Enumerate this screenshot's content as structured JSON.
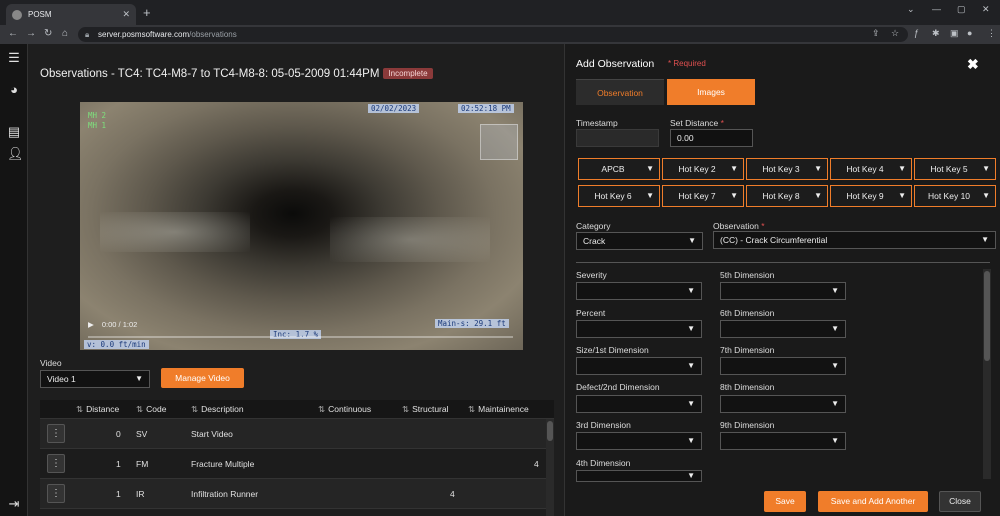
{
  "browser": {
    "tab_title": "POSM",
    "url_domain": "server.posmsoftware.com",
    "url_path": "/observations"
  },
  "main": {
    "title": "Observations - TC4: TC4-M8-7 to TC4-M8-8: 05-05-2009 01:44PM",
    "status": "Incomplete",
    "video_overlay": {
      "mh_top": "MH 2",
      "mh_bottom": "MH 1",
      "date": "02/02/2023",
      "time": "02:52:18 PM",
      "time_display": "0:00 / 1:02",
      "main_s": "Main-s:",
      "main_s_val": "29.1 ft",
      "inc": "Inc:",
      "inc_val": "1.7 %",
      "v_label": "v:",
      "v_val": "0.0 ft/min"
    },
    "video_label": "Video",
    "video_select": "Video 1",
    "manage_video": "Manage Video",
    "table": {
      "columns": [
        "Distance",
        "Code",
        "Description",
        "Continuous",
        "Structural",
        "Maintainence"
      ],
      "rows": [
        {
          "distance": "0",
          "code": "SV",
          "description": "Start Video",
          "continuous": "",
          "structural": "",
          "maintenance": ""
        },
        {
          "distance": "1",
          "code": "FM",
          "description": "Fracture Multiple",
          "continuous": "",
          "structural": "",
          "maintenance": "4"
        },
        {
          "distance": "1",
          "code": "IR",
          "description": "Infiltration Runner",
          "continuous": "",
          "structural": "4",
          "maintenance": ""
        }
      ]
    }
  },
  "panel": {
    "title": "Add Observation",
    "required": "* Required",
    "tabs": [
      "Observation",
      "Images"
    ],
    "timestamp_label": "Timestamp",
    "set_distance_label": "Set Distance",
    "set_distance_value": "0.00",
    "hotkeys": [
      "APCB",
      "Hot Key 2",
      "Hot Key 3",
      "Hot Key 4",
      "Hot Key 5",
      "Hot Key 6",
      "Hot Key 7",
      "Hot Key 8",
      "Hot Key 9",
      "Hot Key 10"
    ],
    "category_label": "Category",
    "category_value": "Crack",
    "observation_label": "Observation",
    "observation_value": "(CC) - Crack Circumferential",
    "left_fields": [
      "Severity",
      "Percent",
      "Size/1st Dimension",
      "Defect/2nd Dimension",
      "3rd Dimension",
      "4th Dimension"
    ],
    "right_fields": [
      "5th Dimension",
      "6th Dimension",
      "7th Dimension",
      "8th Dimension",
      "9th Dimension"
    ],
    "buttons": {
      "save": "Save",
      "save_add": "Save and Add Another",
      "close": "Close"
    }
  },
  "colors": {
    "accent": "#f07d2a",
    "badge": "#8b3a3a",
    "required": "#e05050"
  }
}
